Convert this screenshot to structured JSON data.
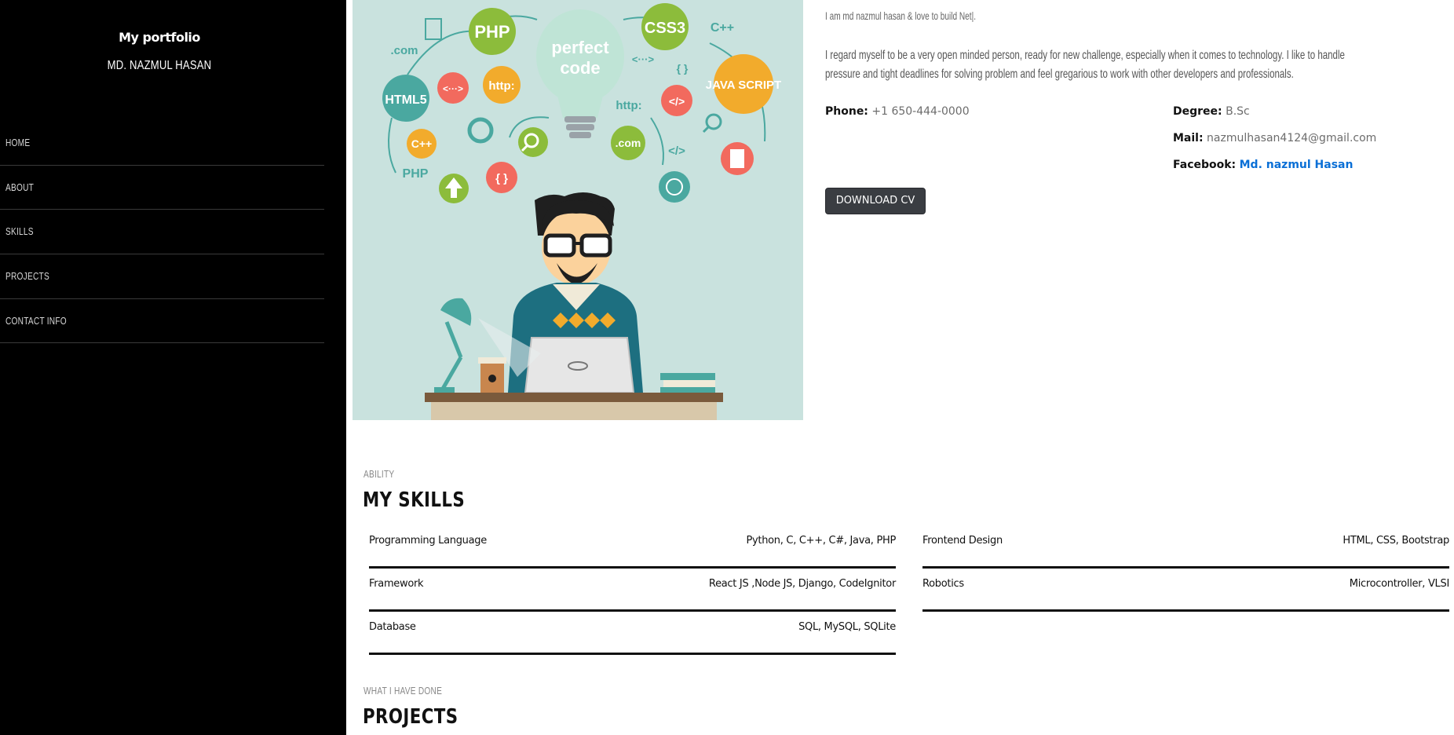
{
  "sidebar": {
    "brand_title": "My portfolio",
    "owner_name": "MD. NAZMUL HASAN",
    "nav": [
      "Home",
      "About",
      "Skills",
      "Projects",
      "Contact Info"
    ]
  },
  "hero": {
    "bulb_text_1": "perfect",
    "bulb_text_2": "code",
    "tags": {
      "php": "PHP",
      "css3": "CSS3",
      "html5": "HTML5",
      "javascript": "JAVA SCRIPT",
      "http1": "http:",
      "http2": "http:",
      "cpp1": "C++",
      "cpp2": "C++",
      "dotcom1": ".com",
      "dotcom2": ".com",
      "php_small": "PHP",
      "code_tag": "</>",
      "code_tag2": "</>",
      "braces": "{ }",
      "braces2": "{ }",
      "arrows": "<···>",
      "arrows2": "<···>"
    }
  },
  "about": {
    "intro": "I am md nazmul hasan & love to build Net|.",
    "bio": "I regard myself to be a very open minded person, ready for new challenge, especially when it comes to technology. I like to handle pressure and tight deadlines for solving problem and feel gregarious to work with other developers and professionals.",
    "phone_label": "Phone:",
    "phone_value": "+1 650-444-0000",
    "degree_label": "Degree:",
    "degree_value": "B.Sc",
    "mail_label": "Mail:",
    "mail_value": "nazmulhasan4124@gmail.com",
    "facebook_label": "Facebook:",
    "facebook_value": "Md. nazmul Hasan",
    "download_label": "DOWNLOAD CV"
  },
  "skills": {
    "eyebrow": "Ability",
    "heading": "My Skills",
    "left": [
      {
        "name": "Programming Language",
        "value": "Python, C, C++, C#, Java, PHP"
      },
      {
        "name": "Framework",
        "value": "React JS ,Node JS, Django, CodeIgnitor"
      },
      {
        "name": "Database",
        "value": "SQL, MySQL, SQLite"
      }
    ],
    "right": [
      {
        "name": "Frontend Design",
        "value": "HTML, CSS, Bootstrap"
      },
      {
        "name": "Robotics",
        "value": "Microcontroller, VLSI"
      }
    ]
  },
  "projects": {
    "eyebrow": "What I have done",
    "heading": "Projects"
  },
  "colors": {
    "sidebar_bg": "#000000",
    "hero_bg": "#c9e2de",
    "link": "#0a6fd6",
    "button_bg": "#3a3d42"
  }
}
